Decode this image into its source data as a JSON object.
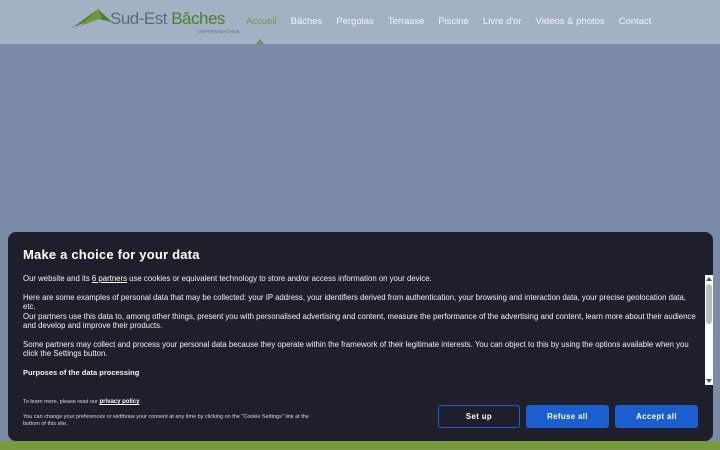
{
  "header": {
    "logo": {
      "text_main": "Sud-Est",
      "text_brand": "Bâches",
      "subtitle": "DEPANN'BACHES"
    },
    "nav": [
      {
        "label": "Accueil",
        "active": true
      },
      {
        "label": "Bâches",
        "active": false
      },
      {
        "label": "Pergolas",
        "active": false
      },
      {
        "label": "Terrasse",
        "active": false
      },
      {
        "label": "Piscine",
        "active": false
      },
      {
        "label": "Livre d'or",
        "active": false
      },
      {
        "label": "Videos & photos",
        "active": false
      },
      {
        "label": "Contact",
        "active": false
      }
    ]
  },
  "consent": {
    "title": "Make a choice for your data",
    "intro_before": "Our website and its ",
    "partners_link": "6 partners",
    "intro_after": " use cookies or equivalent technology to store and/or access information on your device.",
    "p2": "Here are some examples of personal data that may be collected: your IP address, your identifiers derived from authentication, your browsing and interaction data, your precise geolocation data, etc.",
    "p3": "Our partners use this data to, among other things, present you with personalised advertising and content, measure the performance of the advertising and content, learn more about their audience and develop and improve their products.",
    "p4": "Some partners may collect and process your personal data because they operate within the framework of their legitimate interests. You can object to this by using the options available when you click the Settings button.",
    "purposes_heading": "Purposes of the data processing",
    "learn_text": "To learn more, please read our ",
    "privacy_link": "privacy policy",
    "learn_end": ".",
    "change_text": "You can change your preferences or widthraw your consent at any time by clicking on the \"Cookie Settings\" link at the bottom of this site.",
    "buttons": {
      "setup": "Set up",
      "refuse": "Refuse all",
      "accept": "Accept all"
    }
  },
  "colors": {
    "accent_green": "#6e9a3a",
    "button_blue": "#1a5ed0",
    "modal_bg": "#1e1f2b"
  }
}
